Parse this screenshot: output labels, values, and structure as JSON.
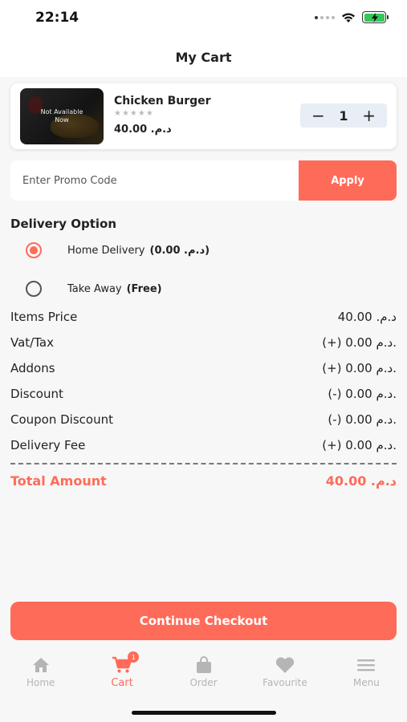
{
  "status_bar": {
    "time": "22:14"
  },
  "header": {
    "title": "My Cart"
  },
  "cart_item": {
    "name": "Chicken Burger",
    "availability": "Not Available Now",
    "rating_stars": "★★★★★",
    "price": "د.م. 40.00",
    "quantity": "1",
    "minus_icon": "minus-icon",
    "plus_icon": "plus-icon"
  },
  "promo": {
    "placeholder": "Enter Promo Code",
    "apply_label": "Apply"
  },
  "delivery": {
    "title": "Delivery Option",
    "options": [
      {
        "label": "Home Delivery",
        "extra": "(د.م. 0.00)",
        "selected": true
      },
      {
        "label": "Take Away",
        "extra": "(Free)",
        "selected": false
      }
    ]
  },
  "summary": {
    "rows": [
      {
        "label": "Items Price",
        "value": "د.م. 40.00"
      },
      {
        "label": "Vat/Tax",
        "value": "(+) 0.00 د.م."
      },
      {
        "label": "Addons",
        "value": "(+) 0.00 د.م."
      },
      {
        "label": "Discount",
        "value": "(-) 0.00 د.م."
      },
      {
        "label": "Coupon Discount",
        "value": "(-) 0.00 د.م."
      },
      {
        "label": "Delivery Fee",
        "value": "(+) 0.00 د.م."
      }
    ],
    "total_label": "Total Amount",
    "total_value": "د.م. 40.00"
  },
  "checkout": {
    "label": "Continue Checkout"
  },
  "nav": {
    "items": [
      {
        "label": "Home",
        "icon": "home-icon"
      },
      {
        "label": "Cart",
        "icon": "cart-icon",
        "badge": "1",
        "active": true
      },
      {
        "label": "Order",
        "icon": "bag-icon"
      },
      {
        "label": "Favourite",
        "icon": "heart-icon"
      },
      {
        "label": "Menu",
        "icon": "menu-icon"
      }
    ]
  },
  "colors": {
    "accent": "#ff6b59",
    "background": "#f7f7f7",
    "inactive": "#b5b5b5"
  }
}
